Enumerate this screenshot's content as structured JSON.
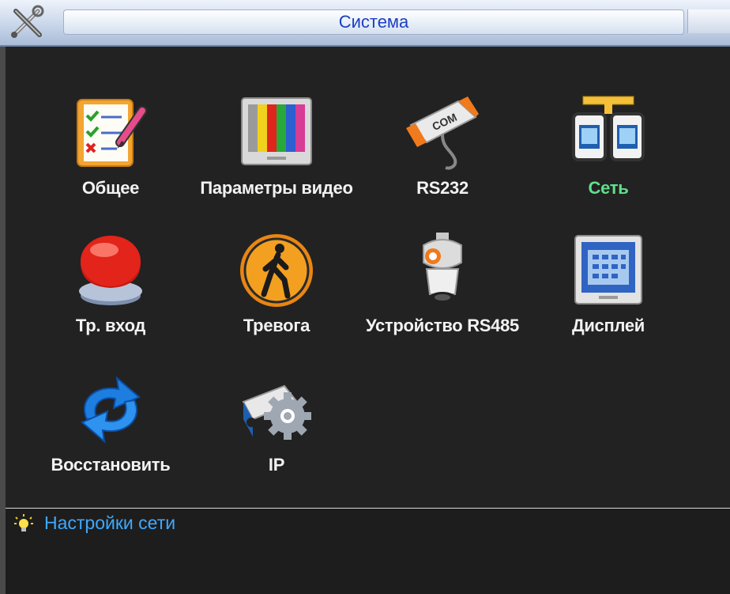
{
  "window": {
    "title": "Система"
  },
  "menu": {
    "items": [
      {
        "label": "Общее",
        "icon": "checklist-icon",
        "selected": false
      },
      {
        "label": "Параметры видео",
        "icon": "color-monitor-icon",
        "selected": false
      },
      {
        "label": "RS232",
        "icon": "com-port-icon",
        "selected": false
      },
      {
        "label": "Сеть",
        "icon": "network-icon",
        "selected": true
      },
      {
        "label": "Тр. вход",
        "icon": "alarm-button-icon",
        "selected": false
      },
      {
        "label": "Тревога",
        "icon": "pedestrian-sign-icon",
        "selected": false
      },
      {
        "label": "Устройство RS485",
        "icon": "ptz-camera-icon",
        "selected": false
      },
      {
        "label": "Дисплей",
        "icon": "display-icon",
        "selected": false
      },
      {
        "label": "Восстановить",
        "icon": "refresh-arrows-icon",
        "selected": false
      },
      {
        "label": "IP",
        "icon": "ip-camera-gear-icon",
        "selected": false
      }
    ]
  },
  "status": {
    "icon": "lightbulb-icon",
    "text": "Настройки сети"
  },
  "colors": {
    "selected_label": "#5fe08a",
    "status_text": "#3ea9ff",
    "title_text": "#1a3fc4"
  }
}
